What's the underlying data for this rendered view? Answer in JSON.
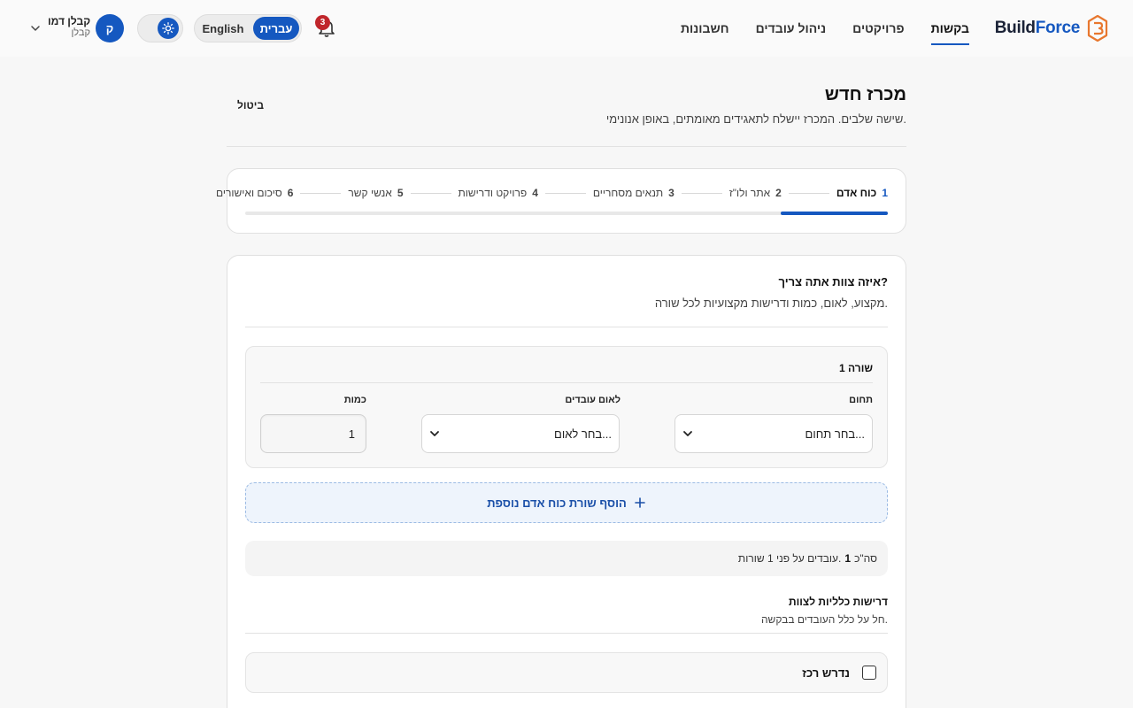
{
  "brand": {
    "part1": "Build",
    "part2": "Force"
  },
  "nav": {
    "items": [
      {
        "label": "בקשות",
        "active": true
      },
      {
        "label": "פרויקטים",
        "active": false
      },
      {
        "label": "ניהול עובדים",
        "active": false
      },
      {
        "label": "חשבונות",
        "active": false
      }
    ]
  },
  "notifications": {
    "count": "3"
  },
  "language": {
    "hebrew": "עברית",
    "english": "English",
    "selected": "עברית"
  },
  "user": {
    "initial": "ק",
    "name": "קבלן דמו",
    "role": "קבלן"
  },
  "page": {
    "title": "מכרז חדש",
    "subtitle": "שישה שלבים. המכרז יישלח לתאגידים מאומתים, באופן אנונימי.",
    "cancel": "ביטול"
  },
  "stepper": {
    "progress": 0.1667,
    "steps": [
      {
        "num": "1",
        "label": "כוח אדם",
        "active": true
      },
      {
        "num": "2",
        "label": "אתר ולו\"ז",
        "active": false
      },
      {
        "num": "3",
        "label": "תנאים מסחריים",
        "active": false
      },
      {
        "num": "4",
        "label": "פרויקט ודרישות",
        "active": false
      },
      {
        "num": "5",
        "label": "אנשי קשר",
        "active": false
      },
      {
        "num": "6",
        "label": "סיכום ואישורים",
        "active": false
      }
    ]
  },
  "manpower": {
    "question": "איזה צוות אתה צריך?",
    "hint": "מקצוע, לאום, כמות ודרישות מקצועיות לכל שורה.",
    "row": {
      "label": "שורה 1",
      "field_label": "תחום",
      "field_value": "בחר תחום...",
      "nationality_label": "לאום עובדים",
      "nationality_value": "בחר לאום...",
      "quantity_label": "כמות",
      "quantity_value": "1"
    },
    "add_row": "הוסף שורת כוח אדם נוספת",
    "summary": {
      "prefix": "סה\"כ",
      "count": "1",
      "suffix": "עובדים על פני 1 שורות."
    },
    "general": {
      "title": "דרישות כלליות לצוות",
      "subtitle": "חל על כלל העובדים בבקשה."
    },
    "foreman": {
      "label": "נדרש רכז",
      "checked": false
    }
  },
  "colors": {
    "accent": "#1558c0",
    "badge": "#c0262b",
    "brand_dark": "#1a2236",
    "logo": "#e8772e"
  },
  "icons": {
    "bell": "bell-icon",
    "theme": "sun-icon",
    "add": "plus-icon",
    "chevron": "chevron-down-icon"
  }
}
